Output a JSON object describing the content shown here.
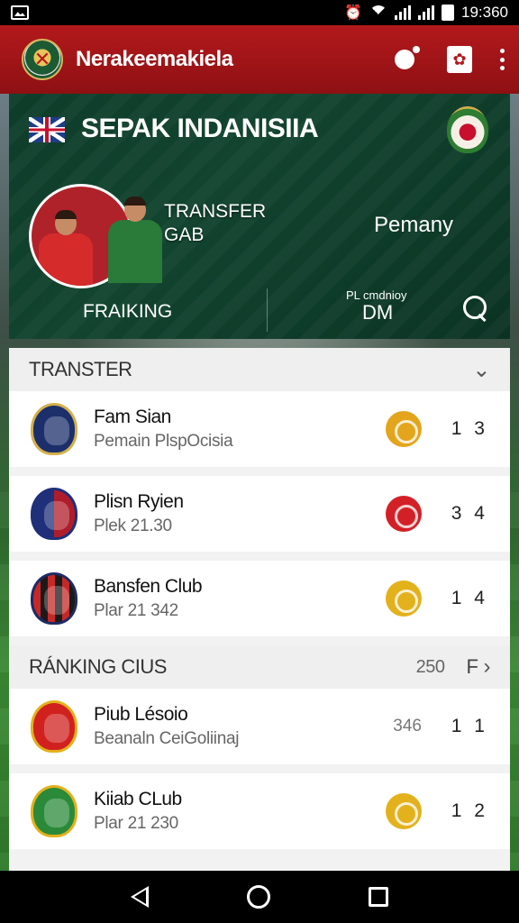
{
  "status_bar": {
    "time": "19:360"
  },
  "app_bar": {
    "title": "Nerakeemakiela"
  },
  "hero": {
    "title": "SEPAK INDANISIIA",
    "transfer_line1": "TRANSFER",
    "transfer_line2": "GAB",
    "right_label": "Pemany",
    "ranking_label": "FRAIKING",
    "small_label": "PL cmdnioy",
    "dm_label": "DM"
  },
  "transfer_section": {
    "title": "TRANSTER",
    "items": [
      {
        "name": "Fam Sian",
        "sub": "Pemain PlspOcisia",
        "score": "1 3",
        "crest_color": "#1c2f6b",
        "badge_color": "#e3a51c"
      },
      {
        "name": "Plisn Ryien",
        "sub": "Plek 21.30",
        "score": "3 4",
        "crest_color": "#b01d2a",
        "badge_color": "#d32027"
      },
      {
        "name": "Bansfen Club",
        "sub": "Plar 21 342",
        "score": "1 4",
        "crest_color": "#1f2a63",
        "badge_color": "#e3b11c"
      }
    ]
  },
  "ranking_section": {
    "title": "RÁNKING CIUS",
    "count": "250",
    "f_label": "F",
    "items": [
      {
        "name": "Piub Lésoio",
        "sub": "Beanaln CeiGoliinaj",
        "mid": "346",
        "score": "1 1",
        "crest_color": "#d0211f"
      },
      {
        "name": "Kiiab CLub",
        "sub": "Plar 21 230",
        "score": "1 2",
        "crest_color": "#2a8a3a",
        "badge_color": "#e3b11c"
      }
    ]
  },
  "colors": {
    "app_bar": "#b3191c",
    "hero_bg": "#0e3d2a"
  }
}
